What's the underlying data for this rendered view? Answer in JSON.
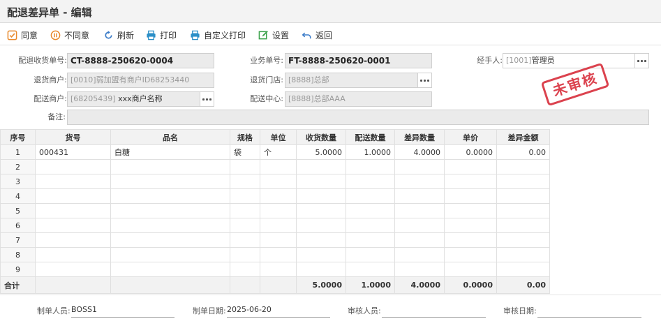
{
  "title": "配退差异单 - 编辑",
  "toolbar": {
    "agree": "同意",
    "disagree": "不同意",
    "refresh": "刷新",
    "print": "打印",
    "custom_print": "自定义打印",
    "settings": "设置",
    "back": "返回"
  },
  "form": {
    "receipt_no_label": "配退收货单号:",
    "receipt_no": "CT-8888-250620-0004",
    "business_no_label": "业务单号:",
    "business_no": "FT-8888-250620-0001",
    "handler_label": "经手人:",
    "handler_code": "[1001]",
    "handler_name": "管理员",
    "return_merchant_label": "退货商户:",
    "return_merchant": "[0010]弱加盟有商户ID68253440",
    "return_store_label": "退货门店:",
    "return_store": "[8888]总部",
    "delivery_merchant_label": "配送商户:",
    "delivery_merchant_code": "[68205439]",
    "delivery_merchant_name": "xxx商户名称",
    "delivery_center_label": "配送中心:",
    "delivery_center": "[8888]总部AAA",
    "remark_label": "备注:",
    "remark": ""
  },
  "stamp": "未审核",
  "table": {
    "headers": [
      "序号",
      "货号",
      "品名",
      "规格",
      "单位",
      "收货数量",
      "配送数量",
      "差异数量",
      "单价",
      "差异金额"
    ],
    "rows": [
      [
        "1",
        "000431",
        "白糖",
        "袋",
        "个",
        "5.0000",
        "1.0000",
        "4.0000",
        "0.0000",
        "0.00"
      ],
      [
        "2",
        "",
        "",
        "",
        "",
        "",
        "",
        "",
        "",
        ""
      ],
      [
        "3",
        "",
        "",
        "",
        "",
        "",
        "",
        "",
        "",
        ""
      ],
      [
        "4",
        "",
        "",
        "",
        "",
        "",
        "",
        "",
        "",
        ""
      ],
      [
        "5",
        "",
        "",
        "",
        "",
        "",
        "",
        "",
        "",
        ""
      ],
      [
        "6",
        "",
        "",
        "",
        "",
        "",
        "",
        "",
        "",
        ""
      ],
      [
        "7",
        "",
        "",
        "",
        "",
        "",
        "",
        "",
        "",
        ""
      ],
      [
        "8",
        "",
        "",
        "",
        "",
        "",
        "",
        "",
        "",
        ""
      ],
      [
        "9",
        "",
        "",
        "",
        "",
        "",
        "",
        "",
        "",
        ""
      ]
    ],
    "total": [
      "合计",
      "",
      "",
      "",
      "",
      "5.0000",
      "1.0000",
      "4.0000",
      "0.0000",
      "0.00"
    ]
  },
  "footer": {
    "creator_label": "制单人员:",
    "creator": "BOSS1",
    "create_date_label": "制单日期:",
    "create_date": "2025-06-20",
    "auditor_label": "审核人员:",
    "auditor": "",
    "audit_date_label": "审核日期:",
    "audit_date": ""
  },
  "colors": {
    "agree_icon": "#e8892b",
    "disagree_icon": "#e8892b",
    "blue_icon": "#3a7bc8",
    "print_icon": "#2b8fc7",
    "settings_icon": "#3aa14a",
    "stamp": "#d9333f"
  },
  "icons": {
    "agree": "checkbox-icon",
    "disagree": "pause-circle-icon",
    "refresh": "refresh-icon",
    "print": "printer-icon",
    "custom_print": "printer-icon",
    "settings": "edit-square-icon",
    "back": "undo-arrow-icon"
  }
}
